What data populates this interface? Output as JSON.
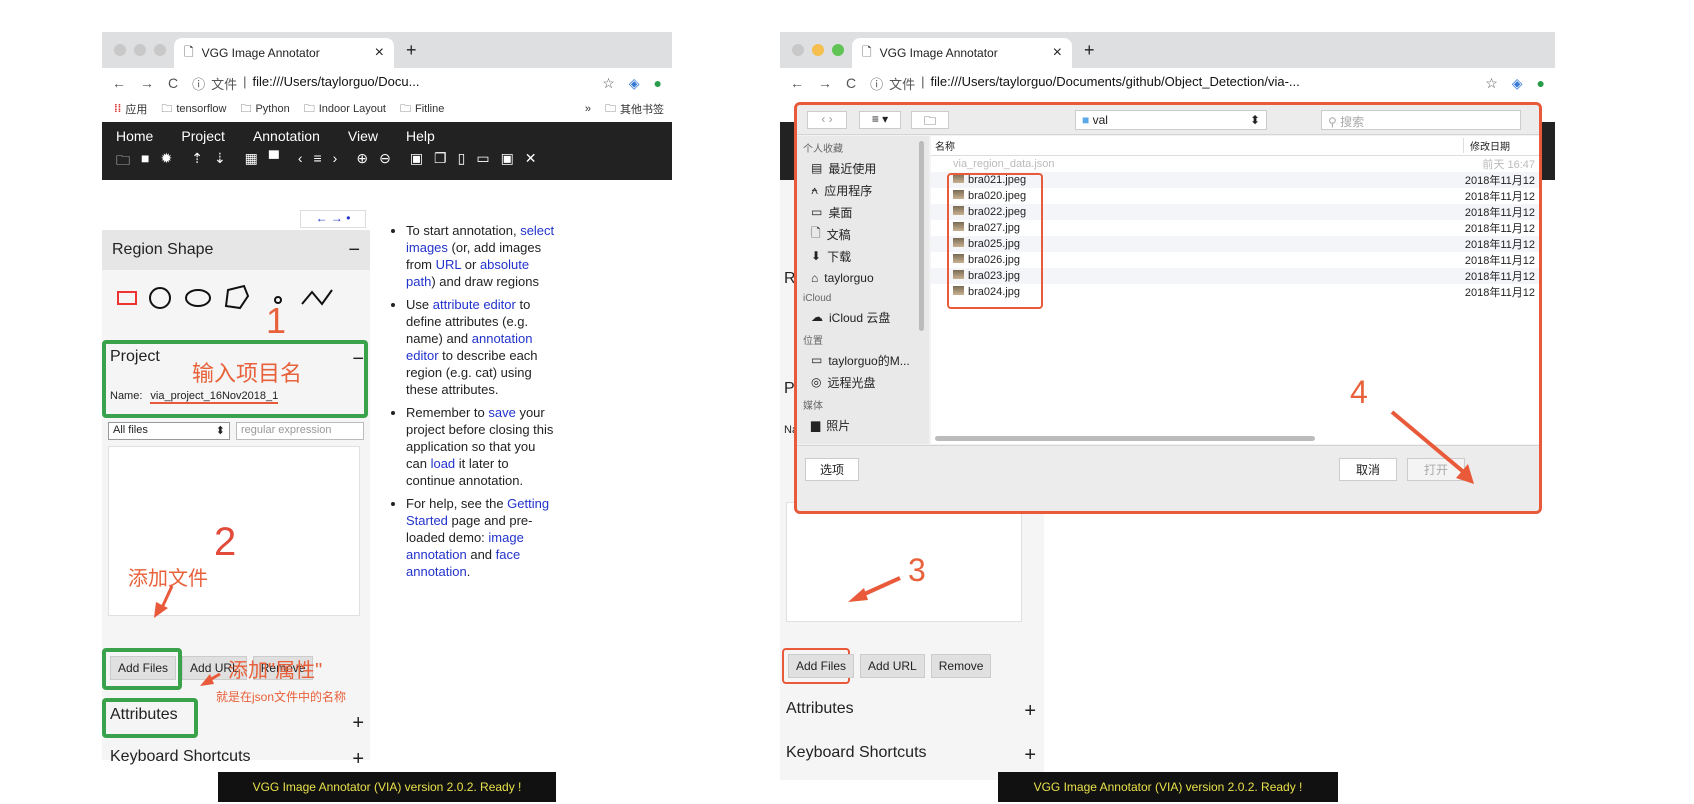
{
  "left": {
    "tab": {
      "title": "VGG Image Annotator",
      "close": "×",
      "new": "+"
    },
    "url": {
      "security": "文件",
      "address": "file:///Users/taylorguo/Docu..."
    },
    "bookmarks": [
      "应用",
      "tensorflow",
      "Python",
      "Indoor Layout",
      "Fitline"
    ],
    "bookmarks_more": "»",
    "bookmarks_other": "其他书签",
    "menu": [
      "Home",
      "Project",
      "Annotation",
      "View",
      "Help"
    ],
    "nav_arrows": "← → •",
    "region_shape": {
      "title": "Region Shape",
      "toggle": "−"
    },
    "project": {
      "title": "Project",
      "toggle": "−",
      "name_label": "Name:",
      "name_value": "via_project_16Nov2018_1"
    },
    "filter": {
      "select": "All files",
      "placeholder": "regular expression"
    },
    "buttons": {
      "add_files": "Add Files",
      "add_url": "Add URL",
      "remove": "Remove"
    },
    "attributes": {
      "title": "Attributes",
      "toggle": "+"
    },
    "shortcuts": {
      "title": "Keyboard Shortcuts",
      "toggle": "+"
    },
    "help": {
      "b1": {
        "a": "To start annotation, ",
        "l1": "select images",
        "b": " (or, add images from ",
        "l2": "URL",
        "c": " or ",
        "l3": "absolute path",
        "d": ") and draw regions"
      },
      "b2": {
        "a": "Use ",
        "l1": "attribute editor",
        "b": " to define attributes (e.g. name) and ",
        "l2": "annotation editor",
        "c": " to describe each region (e.g. cat) using these attributes."
      },
      "b3": {
        "a": "Remember to ",
        "l1": "save",
        "b": " your project before closing this application so that you can ",
        "l2": "load",
        "c": " it later to continue annotation."
      },
      "b4": {
        "a": "For help, see the ",
        "l1": "Getting Started",
        "b": " page and pre-loaded demo: ",
        "l2": "image annotation",
        "c": " and ",
        "l3": "face annotation",
        "d": "."
      }
    },
    "status": "VGG Image Annotator (VIA) version 2.0.2. Ready !",
    "notes": {
      "n1": "1",
      "n1_text": "输入项目名",
      "n2": "2",
      "n2_text": "添加文件",
      "attr_text": "添加\"属性\"",
      "attr_sub": "就是在json文件中的名称"
    }
  },
  "right": {
    "tab": {
      "title": "VGG Image Annotator",
      "close": "×",
      "new": "+"
    },
    "url": {
      "security": "文件",
      "address": "file:///Users/taylorguo/Documents/github/Object_Detection/via-..."
    },
    "dialog": {
      "folder": "val",
      "search_placeholder": "搜索",
      "col_name": "名称",
      "col_date": "修改日期",
      "favorites_header": "个人收藏",
      "favorites": [
        "最近使用",
        "应用程序",
        "桌面",
        "文稿",
        "下载",
        "taylorguo"
      ],
      "icloud_header": "iCloud",
      "icloud": [
        "iCloud 云盘"
      ],
      "locations_header": "位置",
      "locations": [
        "taylorguo的M...",
        "远程光盘"
      ],
      "media_header": "媒体",
      "media": [
        "照片"
      ],
      "dim_file": {
        "name": "via_region_data.json",
        "date": "前天 16:47"
      },
      "files": [
        {
          "name": "bra021.jpeg",
          "date": "2018年11月12"
        },
        {
          "name": "bra020.jpeg",
          "date": "2018年11月12"
        },
        {
          "name": "bra022.jpeg",
          "date": "2018年11月12"
        },
        {
          "name": "bra027.jpg",
          "date": "2018年11月12"
        },
        {
          "name": "bra025.jpg",
          "date": "2018年11月12"
        },
        {
          "name": "bra026.jpg",
          "date": "2018年11月12"
        },
        {
          "name": "bra023.jpg",
          "date": "2018年11月12"
        },
        {
          "name": "bra024.jpg",
          "date": "2018年11月12"
        }
      ],
      "options": "选项",
      "cancel": "取消",
      "open": "打开"
    },
    "side_letters": [
      "R",
      "P",
      "Na"
    ],
    "buttons": {
      "add_files": "Add Files",
      "add_url": "Add URL",
      "remove": "Remove"
    },
    "attributes": {
      "title": "Attributes",
      "toggle": "+"
    },
    "shortcuts": {
      "title": "Keyboard Shortcuts",
      "toggle": "+"
    },
    "status": "VGG Image Annotator (VIA) version 2.0.2. Ready !",
    "notes": {
      "n3": "3",
      "n4": "4"
    }
  },
  "colors": {
    "annotation_red": "#e85a3a",
    "annotation_green": "#3aa24a",
    "link": "#2233cc",
    "status_text": "#e8e04a"
  }
}
